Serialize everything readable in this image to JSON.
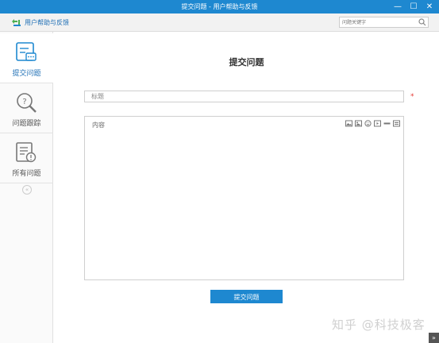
{
  "window": {
    "title": "提交问题 - 用户帮助与反馈",
    "minimize_label": "—",
    "maximize_label": "☐",
    "close_label": "✕"
  },
  "toolbar": {
    "help_label": "用户帮助与反馈",
    "search_placeholder": "问题关键字"
  },
  "sidebar": {
    "items": [
      {
        "label": "提交问题",
        "icon": "submit-issue-icon",
        "active": true
      },
      {
        "label": "问题跟踪",
        "icon": "track-issue-icon",
        "active": false
      },
      {
        "label": "所有问题",
        "icon": "all-issues-icon",
        "active": false
      }
    ],
    "collapse_label": "«"
  },
  "form": {
    "heading": "提交问题",
    "title_placeholder": "标题",
    "required_mark": "*",
    "content_placeholder": "内容",
    "editor_tools": [
      "image-icon",
      "picture-icon",
      "emoji-icon",
      "video-icon",
      "divider-icon",
      "attachment-icon"
    ],
    "submit_label": "提交问题"
  },
  "watermark": "知乎 @科技极客",
  "scroll_top_label": "»",
  "colors": {
    "accent": "#1e88d0",
    "required": "#e53935"
  }
}
